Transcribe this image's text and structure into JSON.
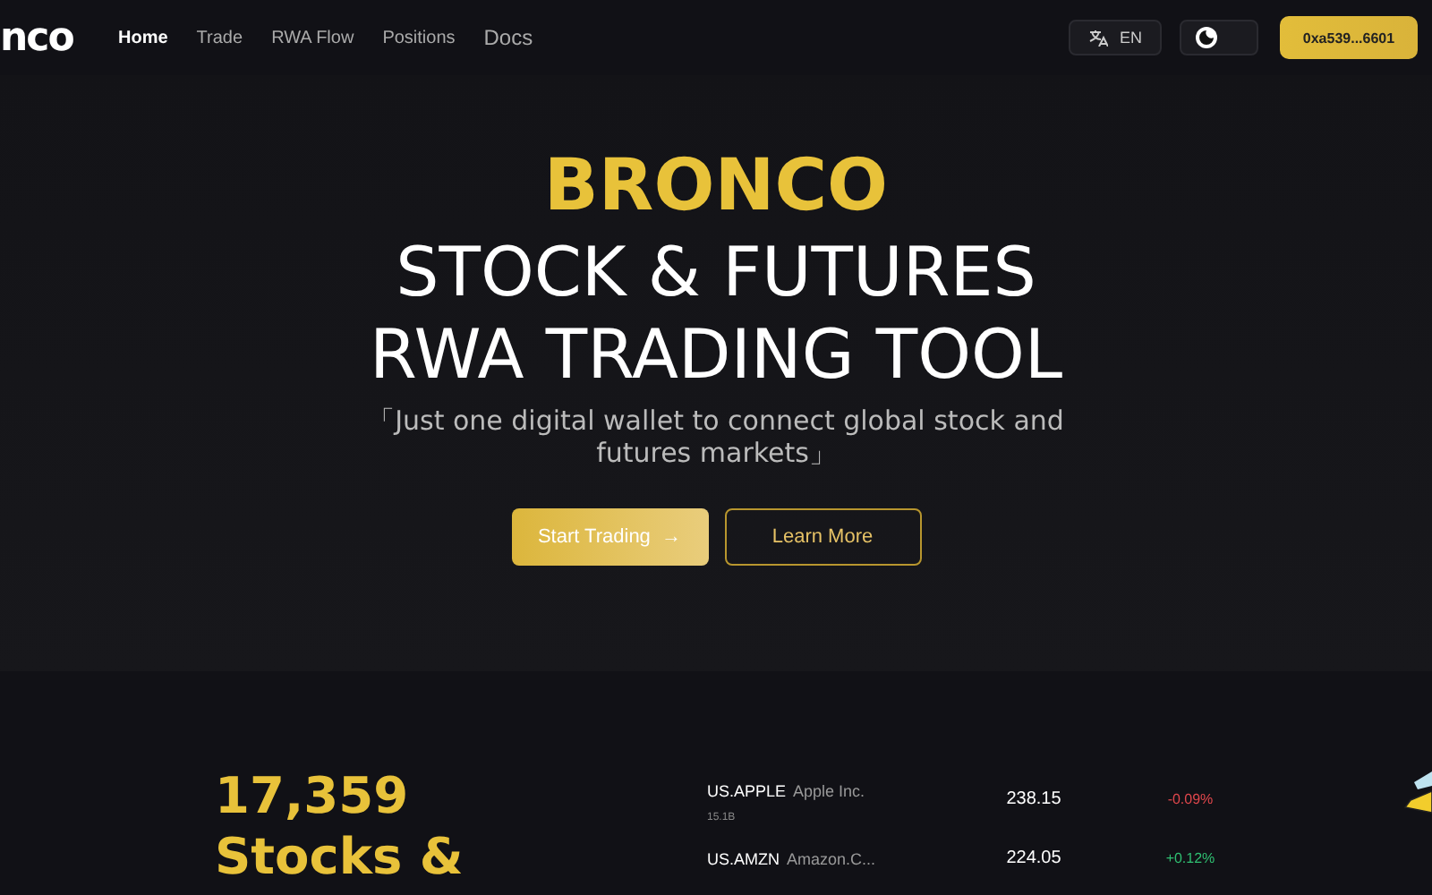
{
  "header": {
    "logo": "nco",
    "nav": [
      {
        "label": "Home",
        "selected": true
      },
      {
        "label": "Trade",
        "selected": false
      },
      {
        "label": "RWA Flow",
        "selected": false
      },
      {
        "label": "Positions",
        "selected": false
      },
      {
        "label": "Docs",
        "selected": false
      }
    ],
    "language": "EN",
    "light_mode": false,
    "wallet": "0xa539...6601"
  },
  "hero": {
    "brand": "BRONCO",
    "headline": [
      "STOCK & FUTURES",
      "RWA TRADING TOOL"
    ],
    "tagline": "「Just one digital wallet to connect global stock and futures markets」",
    "buttons": [
      {
        "kind": "primary",
        "label": "Start Trading",
        "arrow": "→"
      },
      {
        "kind": "outline",
        "label": "Learn More"
      }
    ]
  },
  "stats": {
    "count": "17,359",
    "label": "Stocks &"
  },
  "quotes": [
    {
      "symbol": "US.APPLE",
      "name": "Apple Inc.",
      "volume": "15.1B",
      "price": "238.15",
      "change": "-0.09%",
      "color": "#e0474c"
    },
    {
      "symbol": "US.AMZN",
      "name": "Amazon.C...",
      "price": "224.05",
      "change": "+0.12%",
      "color": "#2fbf71"
    }
  ]
}
